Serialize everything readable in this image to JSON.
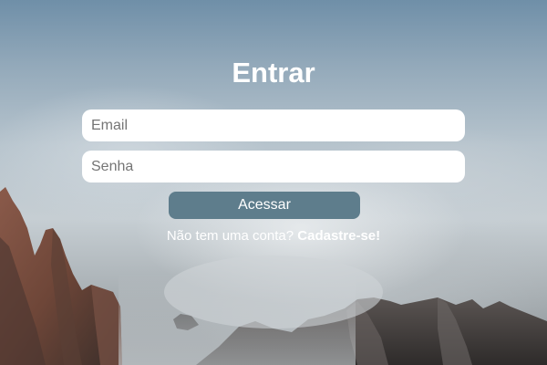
{
  "form": {
    "title": "Entrar",
    "email_placeholder": "Email",
    "password_placeholder": "Senha",
    "submit_label": "Acessar",
    "signup_prompt": "Não tem uma conta?",
    "signup_link": "Cadastre-se!"
  }
}
